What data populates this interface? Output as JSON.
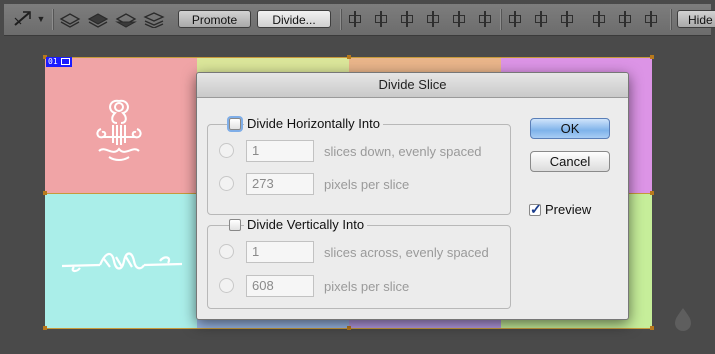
{
  "options_bar": {
    "promote_label": "Promote",
    "divide_label": "Divide...",
    "hide_label": "Hide"
  },
  "canvas": {
    "slice_badge": "01",
    "colors": {
      "pink": "#f0a4a6",
      "lime": "#dbe69a",
      "orange": "#e9b58a",
      "violet": "#dc94e6",
      "cyan": "#aaeee9",
      "blue": "#9ab8e6",
      "purple": "#b49ae2",
      "green": "#c6ee9a"
    }
  },
  "dialog": {
    "title": "Divide Slice",
    "horizontal": {
      "label": "Divide Horizontally Into",
      "checked": false,
      "slices_value": "1",
      "slices_text": "slices down, evenly spaced",
      "pixels_value": "273",
      "pixels_text": "pixels per slice"
    },
    "vertical": {
      "label": "Divide Vertically Into",
      "checked": false,
      "slices_value": "1",
      "slices_text": "slices across, evenly spaced",
      "pixels_value": "608",
      "pixels_text": "pixels per slice"
    },
    "ok_label": "OK",
    "cancel_label": "Cancel",
    "preview_label": "Preview",
    "preview_checked": true
  }
}
